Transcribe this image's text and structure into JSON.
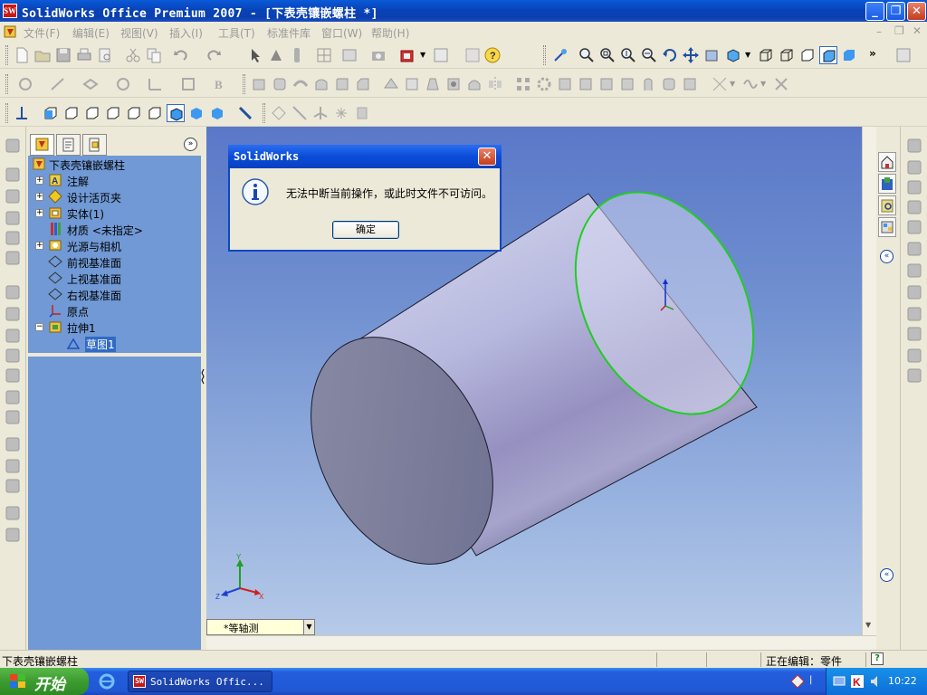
{
  "window": {
    "title": "SolidWorks Office Premium 2007 - [下表壳镶嵌螺柱 *]",
    "app_icon": "SW",
    "buttons": [
      "minimize-icon",
      "restore-icon",
      "close-icon"
    ]
  },
  "menu": {
    "items": [
      {
        "label": "文件(F)",
        "enabled": false
      },
      {
        "label": "编辑(E)",
        "enabled": false
      },
      {
        "label": "视图(V)",
        "enabled": false
      },
      {
        "label": "插入(I)",
        "enabled": false
      },
      {
        "label": "工具(T)",
        "enabled": false
      },
      {
        "label": "标准件库",
        "enabled": false
      },
      {
        "label": "窗口(W)",
        "enabled": false
      },
      {
        "label": "帮助(H)",
        "enabled": false
      }
    ]
  },
  "feature_tree": {
    "tabs": [
      "feature-manager-tab",
      "property-manager-tab",
      "configuration-manager-tab"
    ],
    "root": "下表壳镶嵌螺柱",
    "items": [
      {
        "label": "注解",
        "expand": "+",
        "icon": "annotation-icon",
        "indent": 0
      },
      {
        "label": "设计活页夹",
        "expand": "+",
        "icon": "design-binder-icon",
        "indent": 0
      },
      {
        "label": "实体(1)",
        "expand": "+",
        "icon": "solid-bodies-icon",
        "indent": 0
      },
      {
        "label": "材质 <未指定>",
        "expand": "",
        "icon": "material-icon",
        "indent": 0
      },
      {
        "label": "光源与相机",
        "expand": "+",
        "icon": "lights-cameras-icon",
        "indent": 0
      },
      {
        "label": "前视基准面",
        "expand": "",
        "icon": "plane-icon",
        "indent": 0
      },
      {
        "label": "上视基准面",
        "expand": "",
        "icon": "plane-icon",
        "indent": 0
      },
      {
        "label": "右视基准面",
        "expand": "",
        "icon": "plane-icon",
        "indent": 0
      },
      {
        "label": "原点",
        "expand": "",
        "icon": "origin-icon",
        "indent": 0
      },
      {
        "label": "拉伸1",
        "expand": "−",
        "icon": "extrude-icon",
        "indent": 0
      },
      {
        "label": "草图1",
        "expand": "",
        "icon": "sketch-icon",
        "indent": 1,
        "selected": true
      }
    ]
  },
  "viewport": {
    "view_orientation": "*等轴测",
    "triad": {
      "x": "X",
      "y": "Y",
      "z": "Z"
    }
  },
  "dialog": {
    "title": "SolidWorks",
    "message": "无法中断当前操作，或此时文件不可访问。",
    "ok_label": "确定",
    "icon": "info-icon"
  },
  "statusbar": {
    "left": "下表壳镶嵌螺柱",
    "right": "正在编辑：零件",
    "help_icon": "?"
  },
  "taskbar": {
    "start_label": "开始",
    "task_label": "SolidWorks Offic...",
    "clock": "10:22"
  },
  "colors": {
    "titlebar": "#0a4cd8",
    "tree_bg": "#7099d5",
    "cylinder": "#b0b2d8",
    "highlight_edge": "#22cc22"
  }
}
